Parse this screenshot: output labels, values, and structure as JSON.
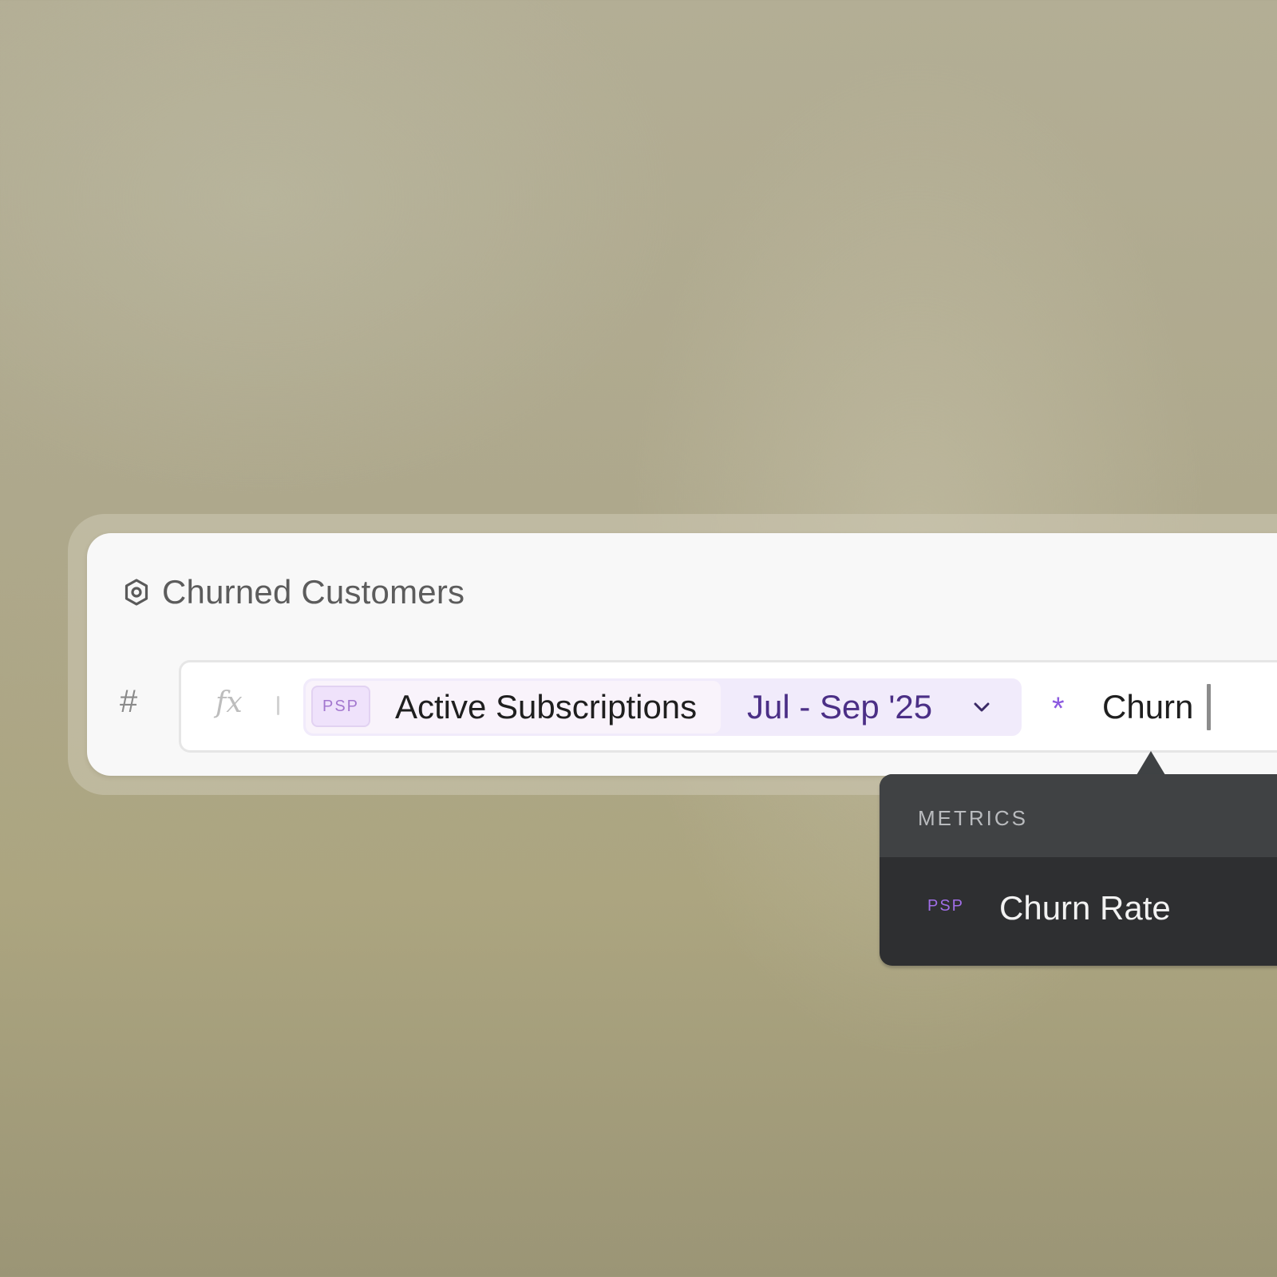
{
  "title": {
    "icon": "hexagon-icon",
    "text": "Churned Customers"
  },
  "formula": {
    "type_symbol": "#",
    "fx_symbol": "fx",
    "metric_badge": "PSP",
    "metric_name": "Active Subscriptions",
    "date_range": "Jul - Sep '25",
    "operator": "*",
    "typed_text": "Churn"
  },
  "autocomplete": {
    "section_header": "METRICS",
    "items": [
      {
        "badge": "PSP",
        "label": "Churn Rate"
      }
    ]
  },
  "colors": {
    "accent_purple": "#8c5ae0",
    "date_text": "#4b2f86",
    "dropdown_bg": "#2e2f31"
  }
}
